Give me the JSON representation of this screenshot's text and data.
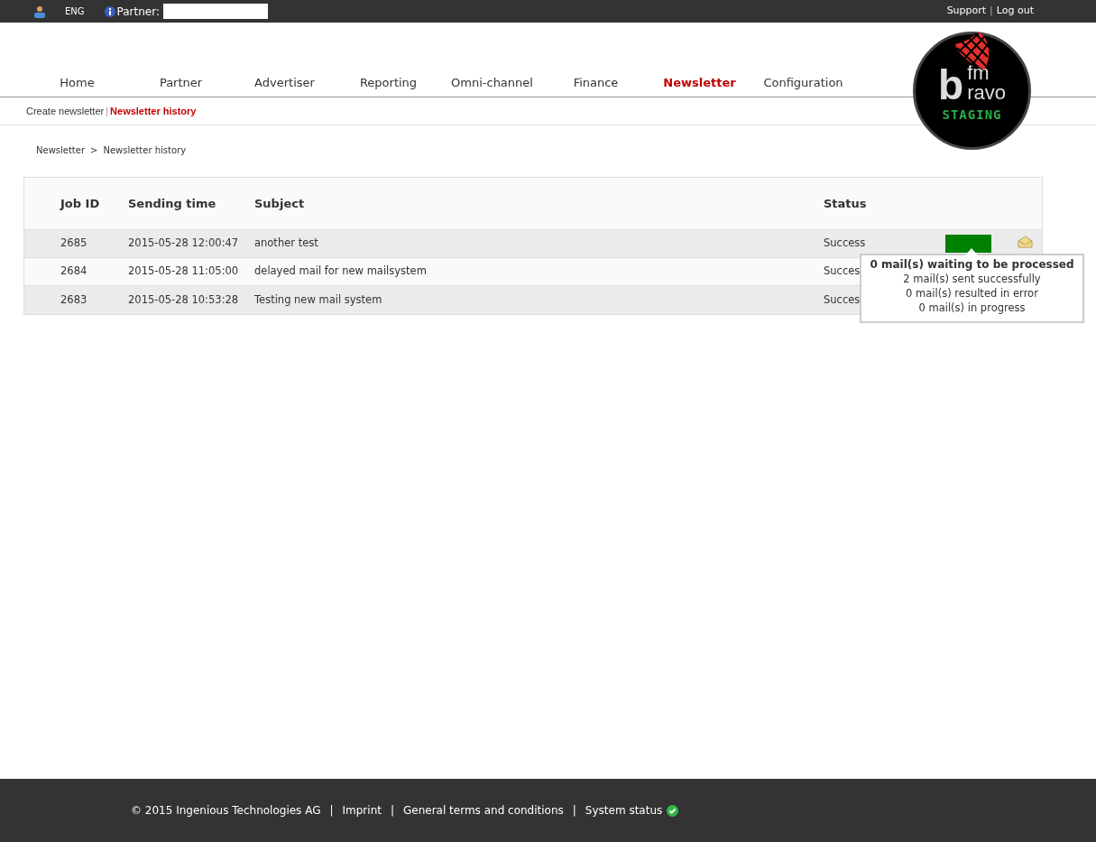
{
  "top_bar": {
    "language": "ENG",
    "partner_label": "Partner:",
    "links": [
      "Support",
      "Log out"
    ],
    "separator": "|"
  },
  "nav": [
    {
      "label": "Home",
      "selected": false
    },
    {
      "label": "Partner",
      "selected": false
    },
    {
      "label": "Advertiser",
      "selected": false
    },
    {
      "label": "Reporting",
      "selected": false
    },
    {
      "label": "Omni-channel",
      "selected": false
    },
    {
      "label": "Finance",
      "selected": false
    },
    {
      "label": "Newsletter",
      "selected": true
    },
    {
      "label": "Configuration",
      "selected": false
    }
  ],
  "logo": {
    "text_b": "b",
    "text_fm": "fm",
    "text_ravo": "ravo",
    "badge": "STAGING"
  },
  "subnav_separator": "|",
  "subnav": [
    {
      "label": "Create newsletter",
      "selected": false
    },
    {
      "label": "Newsletter history",
      "selected": true
    }
  ],
  "breadcrumb": [
    "Newsletter",
    "Newsletter history"
  ],
  "breadcrumb_separator": ">",
  "table": {
    "columns": [
      "Job ID",
      "Sending time",
      "Subject",
      "Status"
    ],
    "rows": [
      {
        "job_id": "2685",
        "sending_time": "2015-05-28 12:00:47",
        "subject": "another test",
        "status": "Success",
        "level": 1
      },
      {
        "job_id": "2684",
        "sending_time": "2015-05-28 11:05:00",
        "subject": "delayed mail for new mailsystem",
        "status": "Succes"
      },
      {
        "job_id": "2683",
        "sending_time": "2015-05-28 10:53:28",
        "subject": "Testing new mail system",
        "status": "Succes"
      }
    ]
  },
  "tooltip": {
    "title": "0 mail(s) waiting to be processed",
    "lines": [
      "2 mail(s) sent successfully",
      "0 mail(s) resulted in error",
      "0 mail(s) in progress"
    ]
  },
  "footer": {
    "copyright": "© 2015 Ingenious Technologies AG",
    "links": [
      "Imprint",
      "General terms and conditions",
      "System status"
    ],
    "separator": "|"
  }
}
